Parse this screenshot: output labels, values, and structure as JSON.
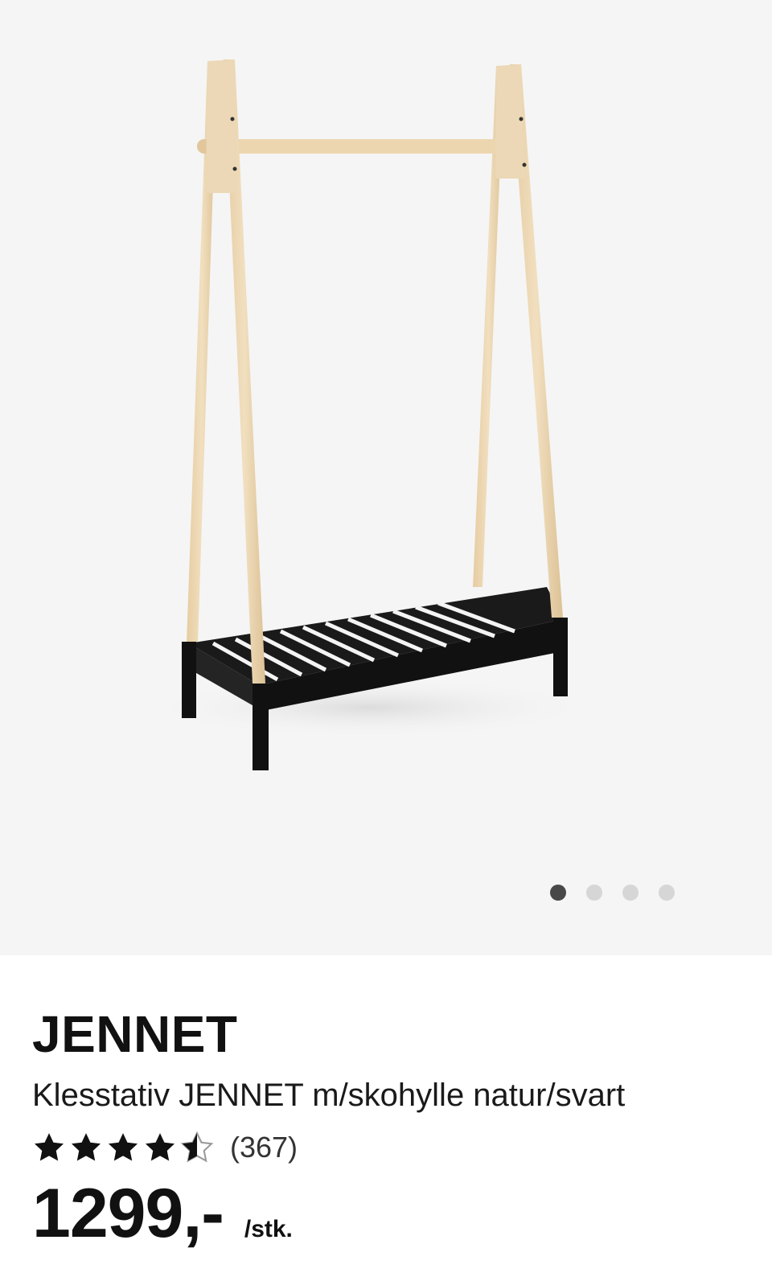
{
  "product": {
    "brand": "JENNET",
    "description": "Klesstativ JENNET m/skohylle natur/svart",
    "rating": {
      "value": 4.5,
      "max": 5,
      "count_text": "(367)"
    },
    "price": {
      "amount": "1299,-",
      "unit": "/stk."
    }
  },
  "gallery": {
    "image_icon": "clothes-rack-with-shoe-shelf",
    "slides": 4,
    "active_slide": 1
  },
  "colors": {
    "gallery_bg": "#f5f5f5",
    "wood": "#ecd7b4",
    "black": "#151515",
    "dot_active": "#484848",
    "dot_inactive": "#d6d6d6"
  }
}
